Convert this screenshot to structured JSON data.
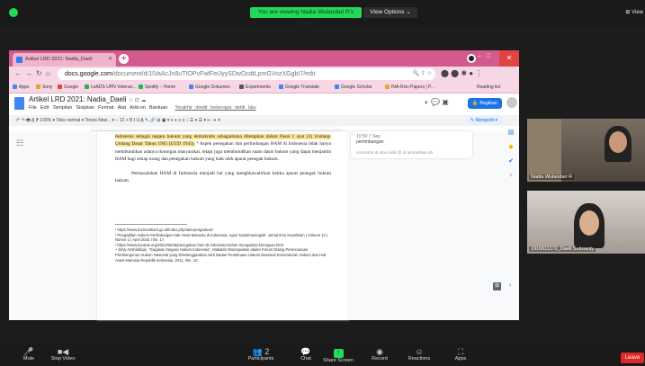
{
  "zoom": {
    "share_banner": "You are viewing Nadia Wulandari R's screen",
    "view_options": "View Options ⌄",
    "view_right": "⊞ View",
    "bottom": [
      {
        "label": "Mute",
        "icon": "🎤"
      },
      {
        "label": "Stop Video",
        "icon": "■◀"
      },
      {
        "label": "Participants",
        "icon": "👥 2"
      },
      {
        "label": "Chat",
        "icon": "💬"
      },
      {
        "label": "Share Screen",
        "icon": "↑"
      },
      {
        "label": "Record",
        "icon": "◉"
      },
      {
        "label": "Reactions",
        "icon": "☺"
      },
      {
        "label": "Apps",
        "icon": "⛶"
      }
    ],
    "leave": "Leave",
    "participants": [
      {
        "name": "Nadia Wulandari R"
      },
      {
        "name": "1910611172_Daeli Subrianty"
      }
    ]
  },
  "browser": {
    "tab_title": "Artikel LRD 2021: Nadia_Daeli",
    "url_prefix": "docs.google.com",
    "url_rest": "/document/d/1lVaAcJn8uTIOPvFwlFeiJyySDwOcdtLpmGVozXGgbI7/edit",
    "bookmarks": [
      {
        "label": "Apps",
        "color": "#4285f4"
      },
      {
        "label": "Sony",
        "color": "#e8a33d"
      },
      {
        "label": "Google",
        "color": "#ea4335"
      },
      {
        "label": "LeADS UPN Veteran...",
        "color": "#34a853"
      },
      {
        "label": "Spotify – Home",
        "color": "#1db954"
      },
      {
        "label": "Google Dokumen",
        "color": "#4285f4"
      },
      {
        "label": "Experiments",
        "color": "#555555"
      },
      {
        "label": "Google Translate",
        "color": "#4285f4"
      },
      {
        "label": "Google Scholar",
        "color": "#4285f4"
      },
      {
        "label": "INA-Rxiv Papers | P...",
        "color": "#e8a33d"
      }
    ],
    "reading_list": "Reading list"
  },
  "docs": {
    "title": "Artikel LRD 2021: Nadia_Daeli",
    "menu": [
      "File",
      "Edit",
      "Tampilan",
      "Sisipkan",
      "Format",
      "Alat",
      "Add-on",
      "Bantuan"
    ],
    "last_edit": "Terakhir diedit beberapa detik lalu",
    "share": "Bagikan",
    "edit_mode": "Mengedit",
    "toolbar": "↶ ↷ 🖶 A̲ ⁋   100% ▾   Teks normal ▾   Times New... ▾   −  12  +   B  I  U  A̲  ✎   🔗  ⊞  ▣  ▾   ≡  ≡  ≡  ≡   ↕   ☰ ▾  ☰ ▾   ⇤  ⇥   ✕",
    "para1_hl": "Indonesia sebagai negara hukum yang demokratis sebagaimana ditetapkan dalam Pasal 1 ayat (3) Undang-Undang Dasar Tahun 1945 (UUD 1945).",
    "para1_rest": "⁴ Aspek penegakan dan perlindungan HAM di Indonesia tidak hanya membutuhkan adanya dorongan masyarakat, tetapi juga membutuhkan suatu dasar hukum yang dapat menjamin HAM bagi setiap orang dan penegakan hukum yang baik oleh aparat penegak hukum.",
    "para2": "Permasalahan HAM di Indonesia menjadi hal yang menghkawatirkan ketika aparat penegak hukum hukum.",
    "footnotes": [
      "¹ https://www.komnasham.go.id/index.php/tata-pengaduan/",
      "² Pengadilan Hukum Perlindungan Hak Asasi Manusia di Indonesia, Agus Sudarmaningsih. Jurnal Ilmu Kepolisian | Volume 14 | Nomor 1 | April 2020, hlm. 17.",
      "³ https://www.kontras.org/2021/06/26/penegakan-ham-di-indonesia-belum-mengalami-kemajuan.html",
      "⁴ Jimly Asshiddiqie, \"Gagasan Negara Hukum Indonesia\", Makalah Disampaikan dalam Forum Dialog Perencanaan Pembangunan Hukum Nasional yang Diselenggarakan oleh Badan Pembinaan Hukum Nasional Kementerian Hukum dan Hak Asasi Manusia Republik Indonesia, 2011, hlm. 10."
    ],
    "comment_time": "10:50 7 Sep",
    "comment_text": "pertimbangan",
    "comment_placeholder": "Komentar di atau ketik @ di tambahkan ah."
  }
}
